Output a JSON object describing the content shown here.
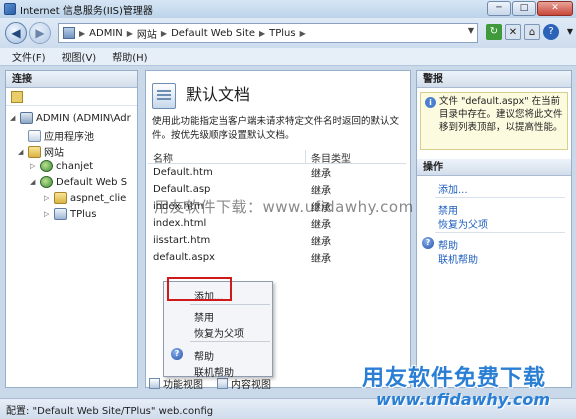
{
  "window": {
    "title": "Internet 信息服务(IIS)管理器",
    "min_label": "─",
    "max_label": "□",
    "close_label": "✕"
  },
  "address": {
    "segments": [
      "ADMIN",
      "网站",
      "Default Web Site",
      "TPlus"
    ]
  },
  "menu": [
    "文件(F)",
    "视图(V)",
    "帮助(H)"
  ],
  "connections": {
    "title": "连接",
    "tree": [
      {
        "label": "ADMIN (ADMIN\\Adr",
        "icon": "server-icon",
        "toggle": "◢"
      },
      {
        "label": "应用程序池",
        "icon": "app-pool-icon",
        "toggle": ""
      },
      {
        "label": "网站",
        "icon": "folder-icon",
        "toggle": "◢"
      },
      {
        "label": "chanjet",
        "icon": "website-icon",
        "toggle": "▷"
      },
      {
        "label": "Default Web S",
        "icon": "website-icon",
        "toggle": "◢"
      },
      {
        "label": "aspnet_clie",
        "icon": "folder-icon",
        "toggle": "▷"
      },
      {
        "label": "TPlus",
        "icon": "application-icon",
        "toggle": "▷"
      }
    ]
  },
  "feature": {
    "title": "默认文档",
    "description": "使用此功能指定当客户端未请求特定文件名时返回的默认文件。按优先级顺序设置默认文档。",
    "columns": [
      "名称",
      "条目类型"
    ],
    "rows": [
      {
        "name": "Default.htm",
        "type": "继承"
      },
      {
        "name": "Default.asp",
        "type": "继承"
      },
      {
        "name": "index.htm",
        "type": "继承"
      },
      {
        "name": "index.html",
        "type": "继承"
      },
      {
        "name": "iisstart.htm",
        "type": "继承"
      },
      {
        "name": "default.aspx",
        "type": "继承"
      }
    ],
    "tabs": [
      "功能视图",
      "内容视图"
    ]
  },
  "context_menu": {
    "items": [
      "添加...",
      "禁用",
      "恢复为父项",
      "帮助",
      "联机帮助"
    ]
  },
  "alerts": {
    "title": "警报",
    "text": "文件 \"default.aspx\" 在当前目录中存在。建议您将此文件移到列表顶部，以提高性能。"
  },
  "actions": {
    "title": "操作",
    "items": [
      "添加...",
      "禁用",
      "恢复为父项",
      "帮助",
      "联机帮助"
    ]
  },
  "status": {
    "config": "配置: \"Default Web Site/TPlus\" web.config"
  },
  "watermark": {
    "text": "用友软件下载：www.ufidawhy.com",
    "logo_big": "用友软件免费下载",
    "logo_small": "www.ufidawhy.com"
  },
  "colors": {
    "accent": "#1d5fbf",
    "highlight_box": "#d0191b"
  }
}
